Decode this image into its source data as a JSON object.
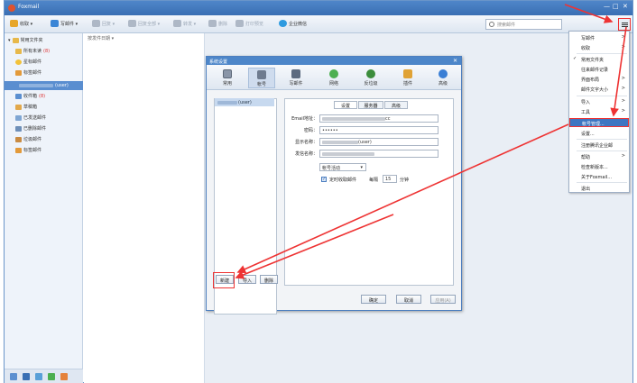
{
  "window": {
    "title": "Foxmail",
    "controls": [
      "—",
      "□",
      "✕"
    ]
  },
  "toolbar": {
    "items": [
      {
        "label": "收取 ▾",
        "icon": "receive-icon",
        "color": "#e7a62a",
        "disabled": false
      },
      {
        "label": "写邮件 ▾",
        "icon": "compose-icon",
        "color": "#3b86d6",
        "disabled": false
      },
      {
        "label": "回复 ▾",
        "icon": "reply-icon",
        "color": "#aeb8c6",
        "disabled": true
      },
      {
        "label": "回复全部 ▾",
        "icon": "reply-all-icon",
        "color": "#aeb8c6",
        "disabled": true
      },
      {
        "label": "转发 ▾",
        "icon": "forward-icon",
        "color": "#aeb8c6",
        "disabled": true
      },
      {
        "label": "删除",
        "icon": "delete-icon",
        "color": "#aeb8c6",
        "disabled": true
      },
      {
        "label": "打印预览",
        "icon": "print-icon",
        "color": "#aeb8c6",
        "disabled": true
      },
      {
        "label": "企业微信",
        "icon": "wecom-icon",
        "color": "#2e9be0",
        "disabled": false
      }
    ],
    "search_placeholder": "搜索邮件"
  },
  "sidebar": {
    "common_header": "常用文件夹",
    "common_items": [
      {
        "label": "所有未读",
        "count": "(8)",
        "icon": "unread-folder-icon"
      },
      {
        "label": "星标邮件",
        "count": "",
        "icon": "star-icon"
      },
      {
        "label": "标签邮件",
        "count": "",
        "icon": "tag-icon"
      }
    ],
    "account_label": "(user)",
    "account_items": [
      {
        "label": "收件箱",
        "count": "(8)",
        "icon": "inbox-icon"
      },
      {
        "label": "草稿箱",
        "count": "",
        "icon": "drafts-icon"
      },
      {
        "label": "已发送邮件",
        "count": "",
        "icon": "sent-icon"
      },
      {
        "label": "已删除邮件",
        "count": "",
        "icon": "trash-icon"
      },
      {
        "label": "垃圾邮件",
        "count": "",
        "icon": "spam-icon"
      },
      {
        "label": "标签邮件",
        "count": "",
        "icon": "tag-icon"
      }
    ]
  },
  "list": {
    "sort_label": "按发件日期 ▾"
  },
  "dialog": {
    "title": "系统设置",
    "close": "✕",
    "tabs": [
      {
        "label": "常用",
        "icon": "general-icon",
        "color": "#8a96a8"
      },
      {
        "label": "帐号",
        "icon": "account-icon",
        "color": "#6e7b8f"
      },
      {
        "label": "写邮件",
        "icon": "compose-settings-icon",
        "color": "#5c6b80"
      },
      {
        "label": "网络",
        "icon": "network-icon",
        "color": "#4caf50"
      },
      {
        "label": "反垃圾",
        "icon": "antispam-icon",
        "color": "#3c8d3c"
      },
      {
        "label": "插件",
        "icon": "plugin-icon",
        "color": "#e0a234"
      },
      {
        "label": "高级",
        "icon": "advanced-icon",
        "color": "#3a7fd5"
      }
    ],
    "account_item": "(user)",
    "sub_tabs": [
      "设置",
      "服务器",
      "高级"
    ],
    "fields": {
      "email_label": "Email地址：",
      "email_value": "cc",
      "password_label": "密码：",
      "password_value": "••••••",
      "display_label": "显示名称：",
      "display_value": "(user)",
      "sender_label": "发信名称："
    },
    "select_value": "帐号活动",
    "auto_receive_label": "定时收取邮件",
    "interval_prefix": "每隔",
    "interval_value": "15",
    "interval_unit": "分钟",
    "buttons": {
      "new": "新建",
      "import": "导入",
      "delete": "删除",
      "ok": "确定",
      "cancel": "取消",
      "apply": "应用(A)"
    }
  },
  "menu": {
    "items": [
      {
        "label": "写邮件",
        "arrow": ">",
        "check": ""
      },
      {
        "label": "收取",
        "arrow": ">",
        "check": ""
      },
      {
        "label": "常用文件夹",
        "arrow": "",
        "check": "✓"
      },
      {
        "label": "往来邮件记录",
        "arrow": "",
        "check": ""
      },
      {
        "label": "界面布局",
        "arrow": ">",
        "check": ""
      },
      {
        "label": "邮件文字大小",
        "arrow": ">",
        "check": ""
      },
      {
        "label": "导入",
        "arrow": ">",
        "check": ""
      },
      {
        "label": "工具",
        "arrow": ">",
        "check": ""
      },
      {
        "label": "帐号管理...",
        "arrow": "",
        "check": ""
      },
      {
        "label": "设置...",
        "arrow": "",
        "check": ""
      },
      {
        "label": "注册腾讯企业邮",
        "arrow": "",
        "check": ""
      },
      {
        "label": "帮助",
        "arrow": ">",
        "check": ""
      },
      {
        "label": "检查新版本...",
        "arrow": "",
        "check": ""
      },
      {
        "label": "关于Foxmail...",
        "arrow": "",
        "check": ""
      },
      {
        "label": "退出",
        "arrow": "",
        "check": ""
      }
    ]
  },
  "colors": {
    "accent": "#3d76c2",
    "annotation": "#ee3333",
    "unread": "#dd3333"
  }
}
